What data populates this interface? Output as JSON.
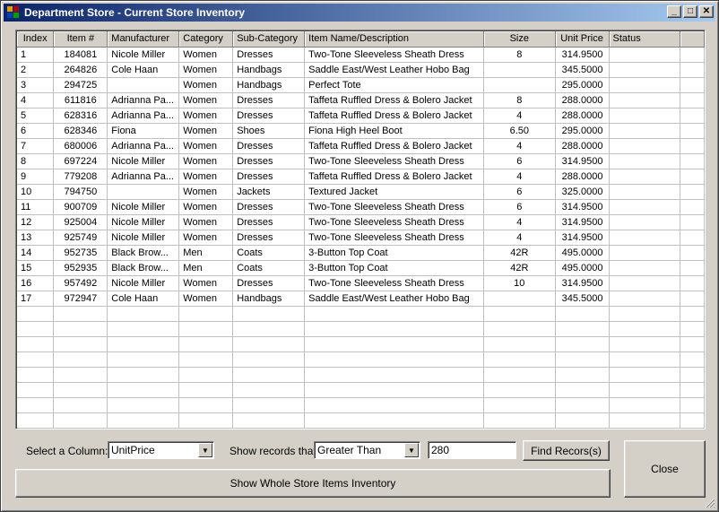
{
  "window": {
    "title": "Department Store - Current Store Inventory",
    "controls": {
      "minimize": "_",
      "maximize": "□",
      "close": "✕"
    }
  },
  "grid": {
    "columns": [
      "Index",
      "Item #",
      "Manufacturer",
      "Category",
      "Sub-Category",
      "Item Name/Description",
      "Size",
      "Unit Price",
      "Status"
    ],
    "rows": [
      [
        "1",
        "184081",
        "Nicole Miller",
        "Women",
        "Dresses",
        "Two-Tone Sleeveless Sheath Dress",
        "8",
        "314.9500",
        ""
      ],
      [
        "2",
        "264826",
        "Cole Haan",
        "Women",
        "Handbags",
        "Saddle East/West Leather Hobo Bag",
        "",
        "345.5000",
        ""
      ],
      [
        "3",
        "294725",
        "",
        "Women",
        "Handbags",
        "Perfect Tote",
        "",
        "295.0000",
        ""
      ],
      [
        "4",
        "611816",
        "Adrianna Pa...",
        "Women",
        "Dresses",
        "Taffeta Ruffled Dress & Bolero Jacket",
        "8",
        "288.0000",
        ""
      ],
      [
        "5",
        "628316",
        "Adrianna Pa...",
        "Women",
        "Dresses",
        "Taffeta Ruffled Dress & Bolero Jacket",
        "4",
        "288.0000",
        ""
      ],
      [
        "6",
        "628346",
        "Fiona",
        "Women",
        "Shoes",
        "Fiona High Heel Boot",
        "6.50",
        "295.0000",
        ""
      ],
      [
        "7",
        "680006",
        "Adrianna Pa...",
        "Women",
        "Dresses",
        "Taffeta Ruffled Dress & Bolero Jacket",
        "4",
        "288.0000",
        ""
      ],
      [
        "8",
        "697224",
        "Nicole Miller",
        "Women",
        "Dresses",
        "Two-Tone Sleeveless Sheath Dress",
        "6",
        "314.9500",
        ""
      ],
      [
        "9",
        "779208",
        "Adrianna Pa...",
        "Women",
        "Dresses",
        "Taffeta Ruffled Dress & Bolero Jacket",
        "4",
        "288.0000",
        ""
      ],
      [
        "10",
        "794750",
        "",
        "Women",
        "Jackets",
        "Textured Jacket",
        "6",
        "325.0000",
        ""
      ],
      [
        "11",
        "900709",
        "Nicole Miller",
        "Women",
        "Dresses",
        "Two-Tone Sleeveless Sheath Dress",
        "6",
        "314.9500",
        ""
      ],
      [
        "12",
        "925004",
        "Nicole Miller",
        "Women",
        "Dresses",
        "Two-Tone Sleeveless Sheath Dress",
        "4",
        "314.9500",
        ""
      ],
      [
        "13",
        "925749",
        "Nicole Miller",
        "Women",
        "Dresses",
        "Two-Tone Sleeveless Sheath Dress",
        "4",
        "314.9500",
        ""
      ],
      [
        "14",
        "952735",
        "Black Brow...",
        "Men",
        "Coats",
        "3-Button Top Coat",
        "42R",
        "495.0000",
        ""
      ],
      [
        "15",
        "952935",
        "Black Brow...",
        "Men",
        "Coats",
        "3-Button Top Coat",
        "42R",
        "495.0000",
        ""
      ],
      [
        "16",
        "957492",
        "Nicole Miller",
        "Women",
        "Dresses",
        "Two-Tone Sleeveless Sheath Dress",
        "10",
        "314.9500",
        ""
      ],
      [
        "17",
        "972947",
        "Cole Haan",
        "Women",
        "Handbags",
        "Saddle East/West Leather Hobo Bag",
        "",
        "345.5000",
        ""
      ]
    ]
  },
  "filter": {
    "select_column_label": "Select a Column:",
    "column_value": "UnitPrice",
    "show_records_label": "Show records that",
    "operator_value": "Greater Than",
    "criteria_value": "280",
    "find_button": "Find Recors(s)",
    "show_all_button": "Show Whole Store Items Inventory",
    "close_button": "Close"
  },
  "colors": {
    "title_start": "#0a246a",
    "title_end": "#a6caf0",
    "face": "#d4d0c8"
  }
}
